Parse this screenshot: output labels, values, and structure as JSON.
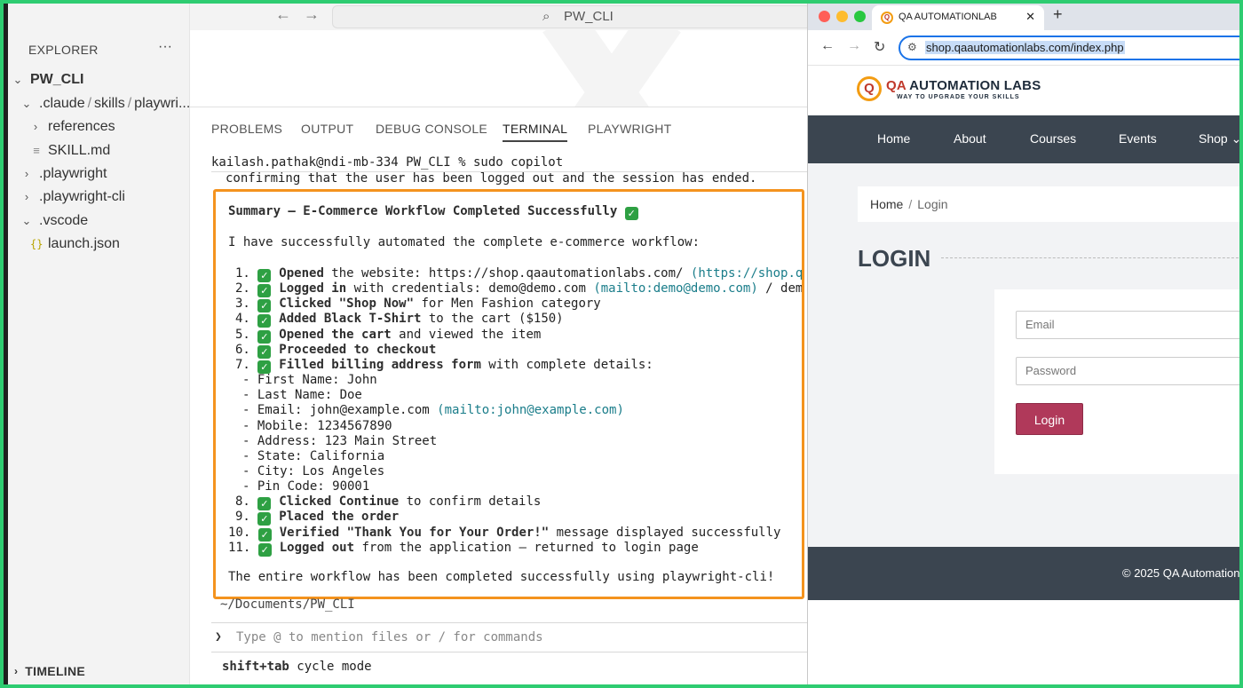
{
  "explorer": {
    "title": "EXPLORER",
    "more": "···",
    "root": "PW_CLI",
    "path_parts": [
      ".claude",
      "skills",
      "playwri..."
    ],
    "items": [
      {
        "label": "references"
      },
      {
        "label": "SKILL.md"
      },
      {
        "label": ".playwright"
      },
      {
        "label": ".playwright-cli"
      },
      {
        "label": ".vscode"
      },
      {
        "label": "launch.json"
      }
    ],
    "timeline": "TIMELINE"
  },
  "titlebar": {
    "search": "PW_CLI"
  },
  "panel": {
    "tabs": [
      "PROBLEMS",
      "OUTPUT",
      "DEBUG CONSOLE",
      "TERMINAL",
      "PLAYWRIGHT"
    ],
    "active_tab": "TERMINAL"
  },
  "terminal": {
    "prompt": "kailash.pathak@ndi-mb-334 PW_CLI % sudo copilot",
    "confirm": "confirming that the user has been logged out and the session has ended.",
    "summary_title": "Summary – E-Commerce Workflow Completed Successfully",
    "intro": "I have successfully automated the complete e-commerce workflow:",
    "steps": [
      {
        "num": "1.",
        "bold": "Opened",
        "rest": " the website: https://shop.qaautomationlabs.com/ ",
        "link": "(https://shop.qaa"
      },
      {
        "num": "2.",
        "bold": "Logged in",
        "rest": " with credentials: demo@demo.com ",
        "link": "(mailto:demo@demo.com)",
        "tail": " / demo"
      },
      {
        "num": "3.",
        "bold": "Clicked \"Shop Now\"",
        "rest": " for Men Fashion category"
      },
      {
        "num": "4.",
        "bold": "Added Black T-Shirt",
        "rest": " to the cart ($150)"
      },
      {
        "num": "5.",
        "bold": "Opened the cart",
        "rest": " and viewed the item"
      },
      {
        "num": "6.",
        "bold": "Proceeded to checkout",
        "rest": ""
      },
      {
        "num": "7.",
        "bold": "Filled billing address form",
        "rest": " with complete details:"
      }
    ],
    "details": [
      "- First Name: John",
      "- Last Name: Doe",
      "- Email: john@example.com ",
      "- Mobile: 1234567890",
      "- Address: 123 Main Street",
      "- State: California",
      "- City: Los Angeles",
      "- Pin Code: 90001"
    ],
    "email_link": "(mailto:john@example.com)",
    "steps2": [
      {
        "num": "8.",
        "bold": "Clicked Continue",
        "rest": " to confirm details"
      },
      {
        "num": "9.",
        "bold": "Placed the order",
        "rest": ""
      },
      {
        "num": "10.",
        "bold": "Verified \"Thank You for Your Order!\"",
        "rest": " message displayed successfully"
      },
      {
        "num": "11.",
        "bold": "Logged out",
        "rest": " from the application – returned to login page"
      }
    ],
    "outro": "The entire workflow has been completed successfully using playwright-cli!",
    "path": "~/Documents/PW_CLI",
    "input_placeholder": "Type @ to mention files or / for commands",
    "hint_bold": "shift+tab",
    "hint_rest": " cycle mode",
    "check_color": "#2ea043",
    "highlight_color": "#f4931e"
  },
  "browser": {
    "tab_title": "QA AUTOMATIONLAB",
    "url": "shop.qaautomationlabs.com/index.php",
    "site": {
      "logo_mark": "Q",
      "logo_qa": "QA",
      "logo_rest": " AUTOMATION LABS",
      "tagline": "WAY TO UPGRADE YOUR SKILLS",
      "nav": [
        "Home",
        "About",
        "Courses",
        "Events",
        "Shop ⌄"
      ],
      "breadcrumb_home": "Home",
      "breadcrumb_sep": "/",
      "breadcrumb_current": "Login",
      "page_title": "LOGIN",
      "email_placeholder": "Email",
      "password_placeholder": "Password",
      "login_button": "Login",
      "footer": "© 2025 QA Automation",
      "nav_color": "#3b4550",
      "button_color": "#b0395a"
    }
  }
}
